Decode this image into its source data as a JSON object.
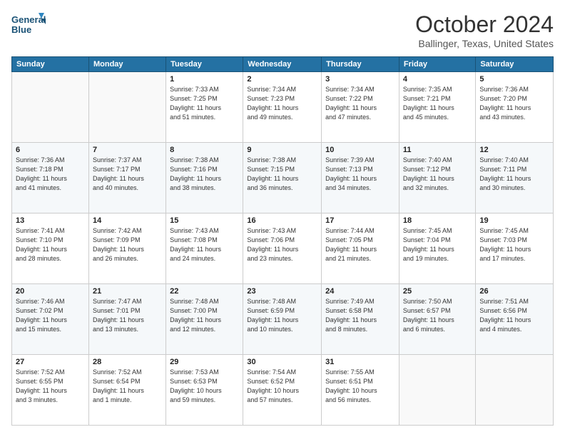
{
  "header": {
    "logo_line1": "General",
    "logo_line2": "Blue",
    "month": "October 2024",
    "location": "Ballinger, Texas, United States"
  },
  "weekdays": [
    "Sunday",
    "Monday",
    "Tuesday",
    "Wednesday",
    "Thursday",
    "Friday",
    "Saturday"
  ],
  "weeks": [
    [
      {
        "day": "",
        "info": ""
      },
      {
        "day": "",
        "info": ""
      },
      {
        "day": "1",
        "info": "Sunrise: 7:33 AM\nSunset: 7:25 PM\nDaylight: 11 hours\nand 51 minutes."
      },
      {
        "day": "2",
        "info": "Sunrise: 7:34 AM\nSunset: 7:23 PM\nDaylight: 11 hours\nand 49 minutes."
      },
      {
        "day": "3",
        "info": "Sunrise: 7:34 AM\nSunset: 7:22 PM\nDaylight: 11 hours\nand 47 minutes."
      },
      {
        "day": "4",
        "info": "Sunrise: 7:35 AM\nSunset: 7:21 PM\nDaylight: 11 hours\nand 45 minutes."
      },
      {
        "day": "5",
        "info": "Sunrise: 7:36 AM\nSunset: 7:20 PM\nDaylight: 11 hours\nand 43 minutes."
      }
    ],
    [
      {
        "day": "6",
        "info": "Sunrise: 7:36 AM\nSunset: 7:18 PM\nDaylight: 11 hours\nand 41 minutes."
      },
      {
        "day": "7",
        "info": "Sunrise: 7:37 AM\nSunset: 7:17 PM\nDaylight: 11 hours\nand 40 minutes."
      },
      {
        "day": "8",
        "info": "Sunrise: 7:38 AM\nSunset: 7:16 PM\nDaylight: 11 hours\nand 38 minutes."
      },
      {
        "day": "9",
        "info": "Sunrise: 7:38 AM\nSunset: 7:15 PM\nDaylight: 11 hours\nand 36 minutes."
      },
      {
        "day": "10",
        "info": "Sunrise: 7:39 AM\nSunset: 7:13 PM\nDaylight: 11 hours\nand 34 minutes."
      },
      {
        "day": "11",
        "info": "Sunrise: 7:40 AM\nSunset: 7:12 PM\nDaylight: 11 hours\nand 32 minutes."
      },
      {
        "day": "12",
        "info": "Sunrise: 7:40 AM\nSunset: 7:11 PM\nDaylight: 11 hours\nand 30 minutes."
      }
    ],
    [
      {
        "day": "13",
        "info": "Sunrise: 7:41 AM\nSunset: 7:10 PM\nDaylight: 11 hours\nand 28 minutes."
      },
      {
        "day": "14",
        "info": "Sunrise: 7:42 AM\nSunset: 7:09 PM\nDaylight: 11 hours\nand 26 minutes."
      },
      {
        "day": "15",
        "info": "Sunrise: 7:43 AM\nSunset: 7:08 PM\nDaylight: 11 hours\nand 24 minutes."
      },
      {
        "day": "16",
        "info": "Sunrise: 7:43 AM\nSunset: 7:06 PM\nDaylight: 11 hours\nand 23 minutes."
      },
      {
        "day": "17",
        "info": "Sunrise: 7:44 AM\nSunset: 7:05 PM\nDaylight: 11 hours\nand 21 minutes."
      },
      {
        "day": "18",
        "info": "Sunrise: 7:45 AM\nSunset: 7:04 PM\nDaylight: 11 hours\nand 19 minutes."
      },
      {
        "day": "19",
        "info": "Sunrise: 7:45 AM\nSunset: 7:03 PM\nDaylight: 11 hours\nand 17 minutes."
      }
    ],
    [
      {
        "day": "20",
        "info": "Sunrise: 7:46 AM\nSunset: 7:02 PM\nDaylight: 11 hours\nand 15 minutes."
      },
      {
        "day": "21",
        "info": "Sunrise: 7:47 AM\nSunset: 7:01 PM\nDaylight: 11 hours\nand 13 minutes."
      },
      {
        "day": "22",
        "info": "Sunrise: 7:48 AM\nSunset: 7:00 PM\nDaylight: 11 hours\nand 12 minutes."
      },
      {
        "day": "23",
        "info": "Sunrise: 7:48 AM\nSunset: 6:59 PM\nDaylight: 11 hours\nand 10 minutes."
      },
      {
        "day": "24",
        "info": "Sunrise: 7:49 AM\nSunset: 6:58 PM\nDaylight: 11 hours\nand 8 minutes."
      },
      {
        "day": "25",
        "info": "Sunrise: 7:50 AM\nSunset: 6:57 PM\nDaylight: 11 hours\nand 6 minutes."
      },
      {
        "day": "26",
        "info": "Sunrise: 7:51 AM\nSunset: 6:56 PM\nDaylight: 11 hours\nand 4 minutes."
      }
    ],
    [
      {
        "day": "27",
        "info": "Sunrise: 7:52 AM\nSunset: 6:55 PM\nDaylight: 11 hours\nand 3 minutes."
      },
      {
        "day": "28",
        "info": "Sunrise: 7:52 AM\nSunset: 6:54 PM\nDaylight: 11 hours\nand 1 minute."
      },
      {
        "day": "29",
        "info": "Sunrise: 7:53 AM\nSunset: 6:53 PM\nDaylight: 10 hours\nand 59 minutes."
      },
      {
        "day": "30",
        "info": "Sunrise: 7:54 AM\nSunset: 6:52 PM\nDaylight: 10 hours\nand 57 minutes."
      },
      {
        "day": "31",
        "info": "Sunrise: 7:55 AM\nSunset: 6:51 PM\nDaylight: 10 hours\nand 56 minutes."
      },
      {
        "day": "",
        "info": ""
      },
      {
        "day": "",
        "info": ""
      }
    ]
  ]
}
